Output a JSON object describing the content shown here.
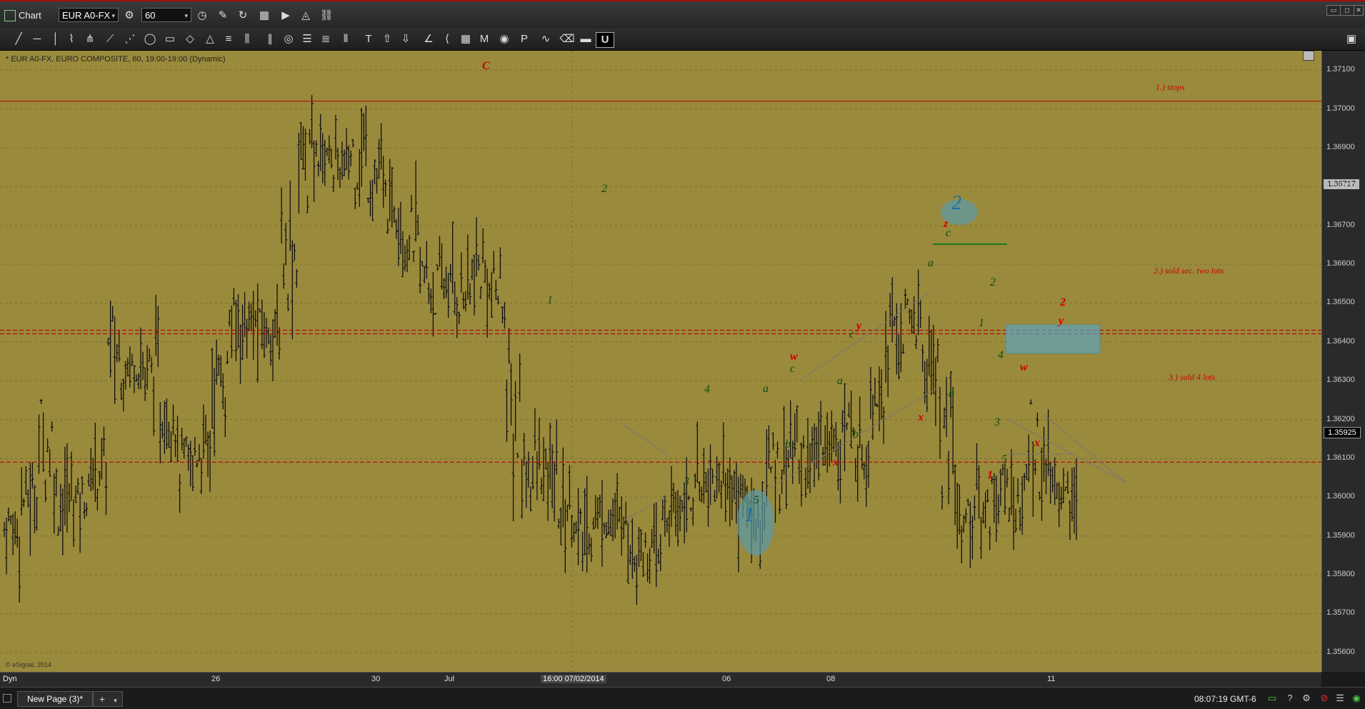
{
  "titlebar": {
    "app_name": "Chart",
    "symbol": "EUR A0-FX",
    "interval": "60",
    "icons": [
      "settings-icon",
      "clock-icon",
      "pencil-icon",
      "refresh-icon",
      "grid-icon",
      "play-icon",
      "alert-icon",
      "link-icon"
    ]
  },
  "drawing_tools": [
    "line-tool",
    "horizontal-line-tool",
    "vertical-line-tool",
    "polyline-tool",
    "pitchfork-tool",
    "gann-fan-tool",
    "fib-fan-tool",
    "ellipse-tool",
    "rectangle-tool",
    "highlighter-tool",
    "triangle-tool",
    "channel-tool",
    "cycle-lines-tool",
    "parallel-lines-tool",
    "fib-circle-tool",
    "fib-retracement-tool",
    "fib-extension-tool",
    "fib-time-tool",
    "text-tool",
    "up-arrow-tool",
    "down-arrow-tool",
    "angle-tool",
    "speed-lines-tool",
    "table-tool",
    "ma-tool",
    "eye-tool",
    "pti-tool",
    "wave-tool",
    "eraser-tool",
    "toggle-tool",
    "magnet-tool"
  ],
  "chart": {
    "title": "* EUR A0-FX, EURO COMPOSITE, 60, 19:00-19:00 (Dynamic)",
    "copyright": "© eSignal, 2014",
    "background": "#9a8a3c",
    "y_axis_labels": [
      "1.37100",
      "1.37000",
      "1.36900",
      "1.36800",
      "1.36700",
      "1.36600",
      "1.36500",
      "1.36400",
      "1.36300",
      "1.36200",
      "1.36100",
      "1.36000",
      "1.35900",
      "1.35800",
      "1.35700",
      "1.35600"
    ],
    "current_price": "1.35925",
    "last_price_label": "1.36717",
    "x_axis_labels": [
      "26",
      "30",
      "Jul",
      "16:00 07/02/2014",
      "06",
      "08",
      "11"
    ],
    "dyn_label": "Dyn",
    "horizontal_notes": [
      {
        "text": "1.) stops",
        "color": "#b01010"
      },
      {
        "text": "2.) sold sec. two lots",
        "color": "#b01010"
      },
      {
        "text": "3.) sold 4 lots",
        "color": "#b01010"
      }
    ],
    "wave_labels_green": [
      "2",
      "1",
      "3",
      "4",
      "5",
      "a",
      "b",
      "c",
      "a",
      "b",
      "c",
      "a",
      "b",
      "c",
      "2",
      "1",
      "4",
      "3",
      "5"
    ],
    "wave_labels_red": [
      "C",
      "w",
      "x",
      "y",
      "x",
      "z",
      "w",
      "x",
      "y",
      "2",
      "1"
    ],
    "wave_labels_blue": [
      "1",
      "2"
    ]
  },
  "chart_data": {
    "type": "ohlc",
    "title": "* EUR A0-FX, EURO COMPOSITE, 60, 19:00-19:00 (Dynamic)",
    "ylim": [
      1.3555,
      1.3715
    ],
    "y_ticks": [
      1.371,
      1.37,
      1.369,
      1.368,
      1.367,
      1.366,
      1.365,
      1.364,
      1.363,
      1.362,
      1.361,
      1.36,
      1.359,
      1.358,
      1.357,
      1.356
    ],
    "x_ticks": [
      "26",
      "30",
      "Jul",
      "16:00 07/02/2014",
      "06",
      "08",
      "11"
    ],
    "horizontal_lines": [
      {
        "label": "1.) stops",
        "value": 1.3702
      },
      {
        "label": "2.) sold sec. two lots",
        "value": 1.3643
      },
      {
        "label": "3.) sold 4 lots",
        "value": 1.3609
      }
    ],
    "current_price": 1.35925,
    "series_envelope": [
      [
        1.3585,
        1.36
      ],
      [
        1.3595,
        1.3605
      ],
      [
        1.36,
        1.3628
      ],
      [
        1.359,
        1.361
      ],
      [
        1.3595,
        1.3605
      ],
      [
        1.36,
        1.3615
      ],
      [
        1.3625,
        1.365
      ],
      [
        1.363,
        1.364
      ],
      [
        1.3625,
        1.364
      ],
      [
        1.3615,
        1.3625
      ],
      [
        1.36,
        1.3615
      ],
      [
        1.3605,
        1.362
      ],
      [
        1.362,
        1.364
      ],
      [
        1.364,
        1.365
      ],
      [
        1.364,
        1.3648
      ],
      [
        1.364,
        1.3645
      ],
      [
        1.365,
        1.368
      ],
      [
        1.3675,
        1.3698
      ],
      [
        1.3685,
        1.3693
      ],
      [
        1.368,
        1.369
      ],
      [
        1.3678,
        1.37
      ],
      [
        1.3675,
        1.369
      ],
      [
        1.367,
        1.368
      ],
      [
        1.366,
        1.3675
      ],
      [
        1.3645,
        1.3665
      ],
      [
        1.365,
        1.366
      ],
      [
        1.3645,
        1.366
      ],
      [
        1.365,
        1.3665
      ],
      [
        1.3645,
        1.366
      ],
      [
        1.36,
        1.364
      ],
      [
        1.36,
        1.3615
      ],
      [
        1.36,
        1.361
      ],
      [
        1.359,
        1.3605
      ],
      [
        1.3585,
        1.3595
      ],
      [
        1.359,
        1.36
      ],
      [
        1.3592,
        1.3597
      ],
      [
        1.3582,
        1.3592
      ],
      [
        1.358,
        1.359
      ],
      [
        1.359,
        1.36
      ],
      [
        1.3595,
        1.3605
      ],
      [
        1.36,
        1.361
      ],
      [
        1.36,
        1.361
      ],
      [
        1.3595,
        1.3605
      ],
      [
        1.359,
        1.36
      ],
      [
        1.36,
        1.3615
      ],
      [
        1.3605,
        1.362
      ],
      [
        1.3605,
        1.3615
      ],
      [
        1.361,
        1.362
      ],
      [
        1.361,
        1.3625
      ],
      [
        1.3605,
        1.362
      ],
      [
        1.362,
        1.3645
      ],
      [
        1.3635,
        1.365
      ],
      [
        1.364,
        1.365
      ],
      [
        1.3625,
        1.3645
      ],
      [
        1.3595,
        1.363
      ],
      [
        1.359,
        1.36
      ],
      [
        1.359,
        1.3605
      ],
      [
        1.3595,
        1.3608
      ],
      [
        1.3593,
        1.3605
      ],
      [
        1.36,
        1.3625
      ],
      [
        1.36,
        1.361
      ],
      [
        1.3595,
        1.3605
      ]
    ]
  },
  "statusbar": {
    "page_tab": "New Page (3)*",
    "add_tab": "+",
    "clock": "08:07:19 GMT-6"
  }
}
